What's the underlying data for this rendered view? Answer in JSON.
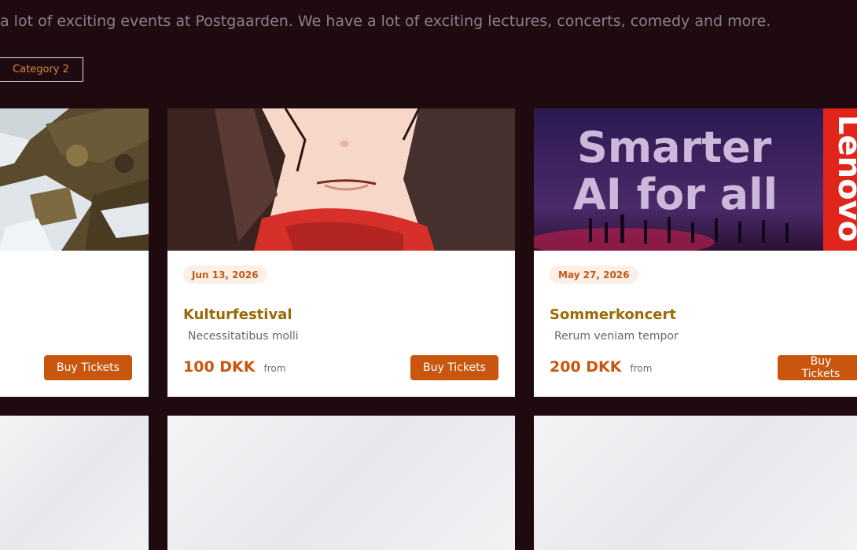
{
  "intro": {
    "text": "a lot of exciting events at Postgaarden. We have a lot of exciting lectures, concerts, comedy and more."
  },
  "filters": {
    "category_label": "Category 2"
  },
  "events": [
    {
      "buy_label": "Buy Tickets"
    },
    {
      "date": "Jun 13, 2026",
      "title": "Kulturfestival",
      "subtitle": "Necessitatibus molli",
      "price": "100 DKK",
      "price_from": "from",
      "buy_label": "Buy Tickets"
    },
    {
      "date": "May 27, 2026",
      "title": "Sommerkoncert",
      "subtitle": "Rerum veniam tempor",
      "price": "200 DKK",
      "price_from": "from",
      "buy_label": "Buy Tickets",
      "image_text": {
        "line1": "Smarter",
        "line2": "AI for all",
        "brand": "Lenovo"
      }
    }
  ],
  "colors": {
    "background": "#1e0a0f",
    "accent": "#c9560f",
    "title": "#9a6a06",
    "badge_bg": "#fbefe6"
  }
}
